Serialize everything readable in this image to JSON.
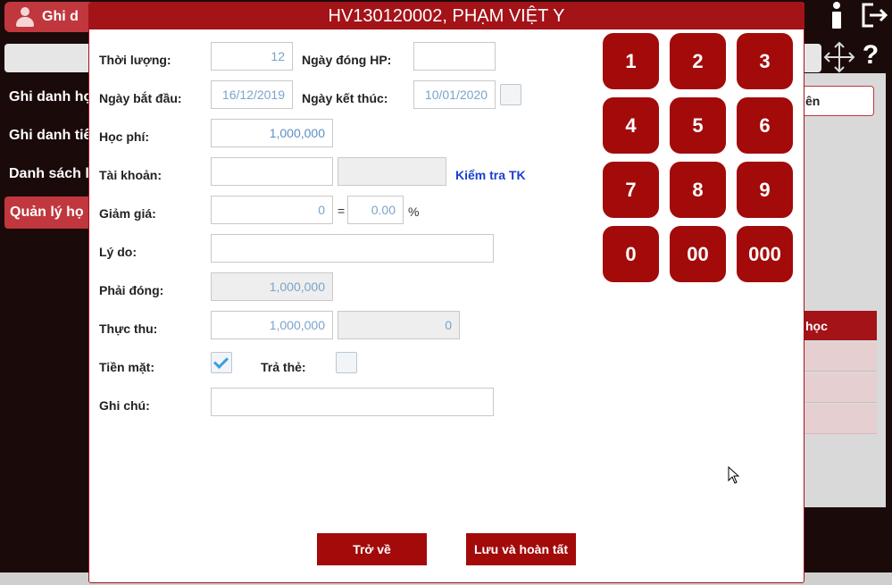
{
  "background": {
    "header_label": "Ghi d",
    "menu": [
      {
        "label": "Ghi danh họ"
      },
      {
        "label": "Ghi danh tiế"
      },
      {
        "label": "Danh sách l"
      },
      {
        "label": "Quản lý họ"
      }
    ],
    "right_button_label": "ên",
    "right_table_header": "học"
  },
  "modal": {
    "title": "HV130120002, PHẠM VIỆT Y",
    "fields": {
      "thoi_luong": {
        "label": "Thời lượng:",
        "value": "12"
      },
      "ngay_dong_hp": {
        "label": "Ngày đóng HP:",
        "value": ""
      },
      "ngay_bat_dau": {
        "label": "Ngày bắt đầu:",
        "value": "16/12/2019"
      },
      "ngay_ket_thuc": {
        "label": "Ngày kết thúc:",
        "value": "10/01/2020"
      },
      "hoc_phi": {
        "label": "Học phí:",
        "value": "1,000,000"
      },
      "tai_khoan": {
        "label": "Tài khoản:",
        "value": "",
        "secondary_value": "",
        "check_link": "Kiểm tra TK"
      },
      "giam_gia": {
        "label": "Giảm giá:",
        "value": "0",
        "equals": "=",
        "percent_value": "0.00",
        "percent_sign": "%"
      },
      "ly_do": {
        "label": "Lý do:",
        "value": ""
      },
      "phai_dong": {
        "label": "Phải đóng:",
        "value": "1,000,000"
      },
      "thuc_thu": {
        "label": "Thực thu:",
        "value": "1,000,000",
        "secondary_value": "0"
      },
      "tien_mat": {
        "label": "Tiền mặt:",
        "checked": true
      },
      "tra_the": {
        "label": "Trả thẻ:",
        "checked": false
      },
      "ghi_chu": {
        "label": "Ghi chú:",
        "value": ""
      }
    },
    "keypad": [
      "1",
      "2",
      "3",
      "4",
      "5",
      "6",
      "7",
      "8",
      "9",
      "0",
      "00",
      "000"
    ],
    "buttons": {
      "back": "Trở về",
      "save": "Lưu và hoàn tất"
    }
  },
  "colors": {
    "accent": "#a31318",
    "key": "#a30a0a",
    "input_text": "#5b8fc9",
    "link": "#1a3fd0"
  }
}
